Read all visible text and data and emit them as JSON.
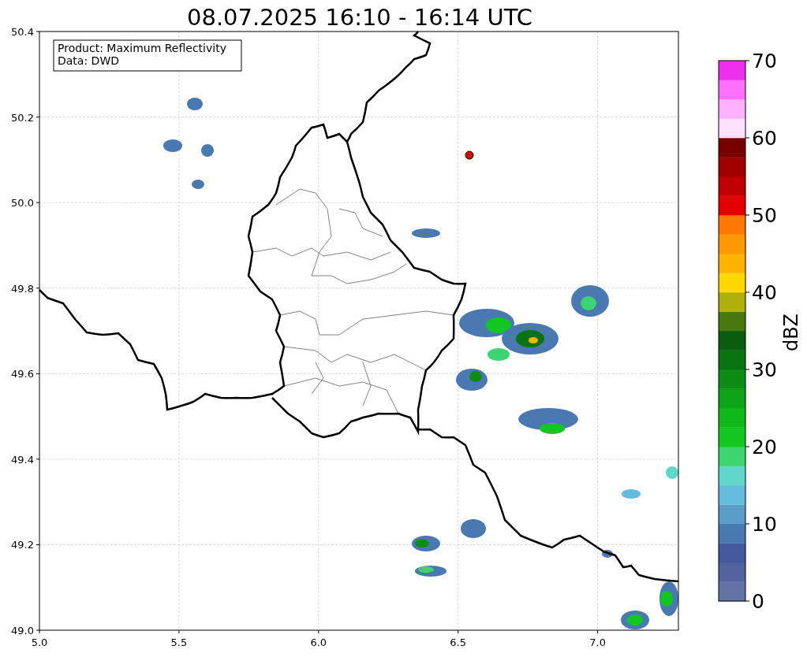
{
  "title": "08.07.2025 16:10 - 16:14 UTC",
  "legend": [
    "Product: Maximum Reflectivity",
    "Data: DWD"
  ],
  "x_ticks": [
    "5.0",
    "5.5",
    "6.0",
    "6.5",
    "7.0"
  ],
  "y_ticks": [
    "50.4",
    "50.2",
    "50.0",
    "49.8",
    "49.6",
    "49.4",
    "49.2",
    "49.0"
  ],
  "colorbar": {
    "label": "dBZ",
    "ticks": [
      "70",
      "60",
      "50",
      "40",
      "30",
      "20",
      "10",
      "0"
    ],
    "bands": [
      {
        "color": "#6272a4"
      },
      {
        "color": "#5264a0"
      },
      {
        "color": "#44589e"
      },
      {
        "color": "#4a78b0"
      },
      {
        "color": "#5a9ec8"
      },
      {
        "color": "#62bcdc"
      },
      {
        "color": "#60d8c8"
      },
      {
        "color": "#3cd470"
      },
      {
        "color": "#12c820"
      },
      {
        "color": "#10b81a"
      },
      {
        "color": "#0ea418"
      },
      {
        "color": "#0c8c14"
      },
      {
        "color": "#0a7412"
      },
      {
        "color": "#0a5c0e"
      },
      {
        "color": "#4a7810"
      },
      {
        "color": "#b0b00a"
      },
      {
        "color": "#ffd800"
      },
      {
        "color": "#ffb400"
      },
      {
        "color": "#ff9800"
      },
      {
        "color": "#ff7800"
      },
      {
        "color": "#e40000"
      },
      {
        "color": "#c00000"
      },
      {
        "color": "#a00000"
      },
      {
        "color": "#780000"
      },
      {
        "color": "#ffe0ff"
      },
      {
        "color": "#ffb0ff"
      },
      {
        "color": "#ff70ff"
      },
      {
        "color": "#ee30ee"
      }
    ]
  }
}
